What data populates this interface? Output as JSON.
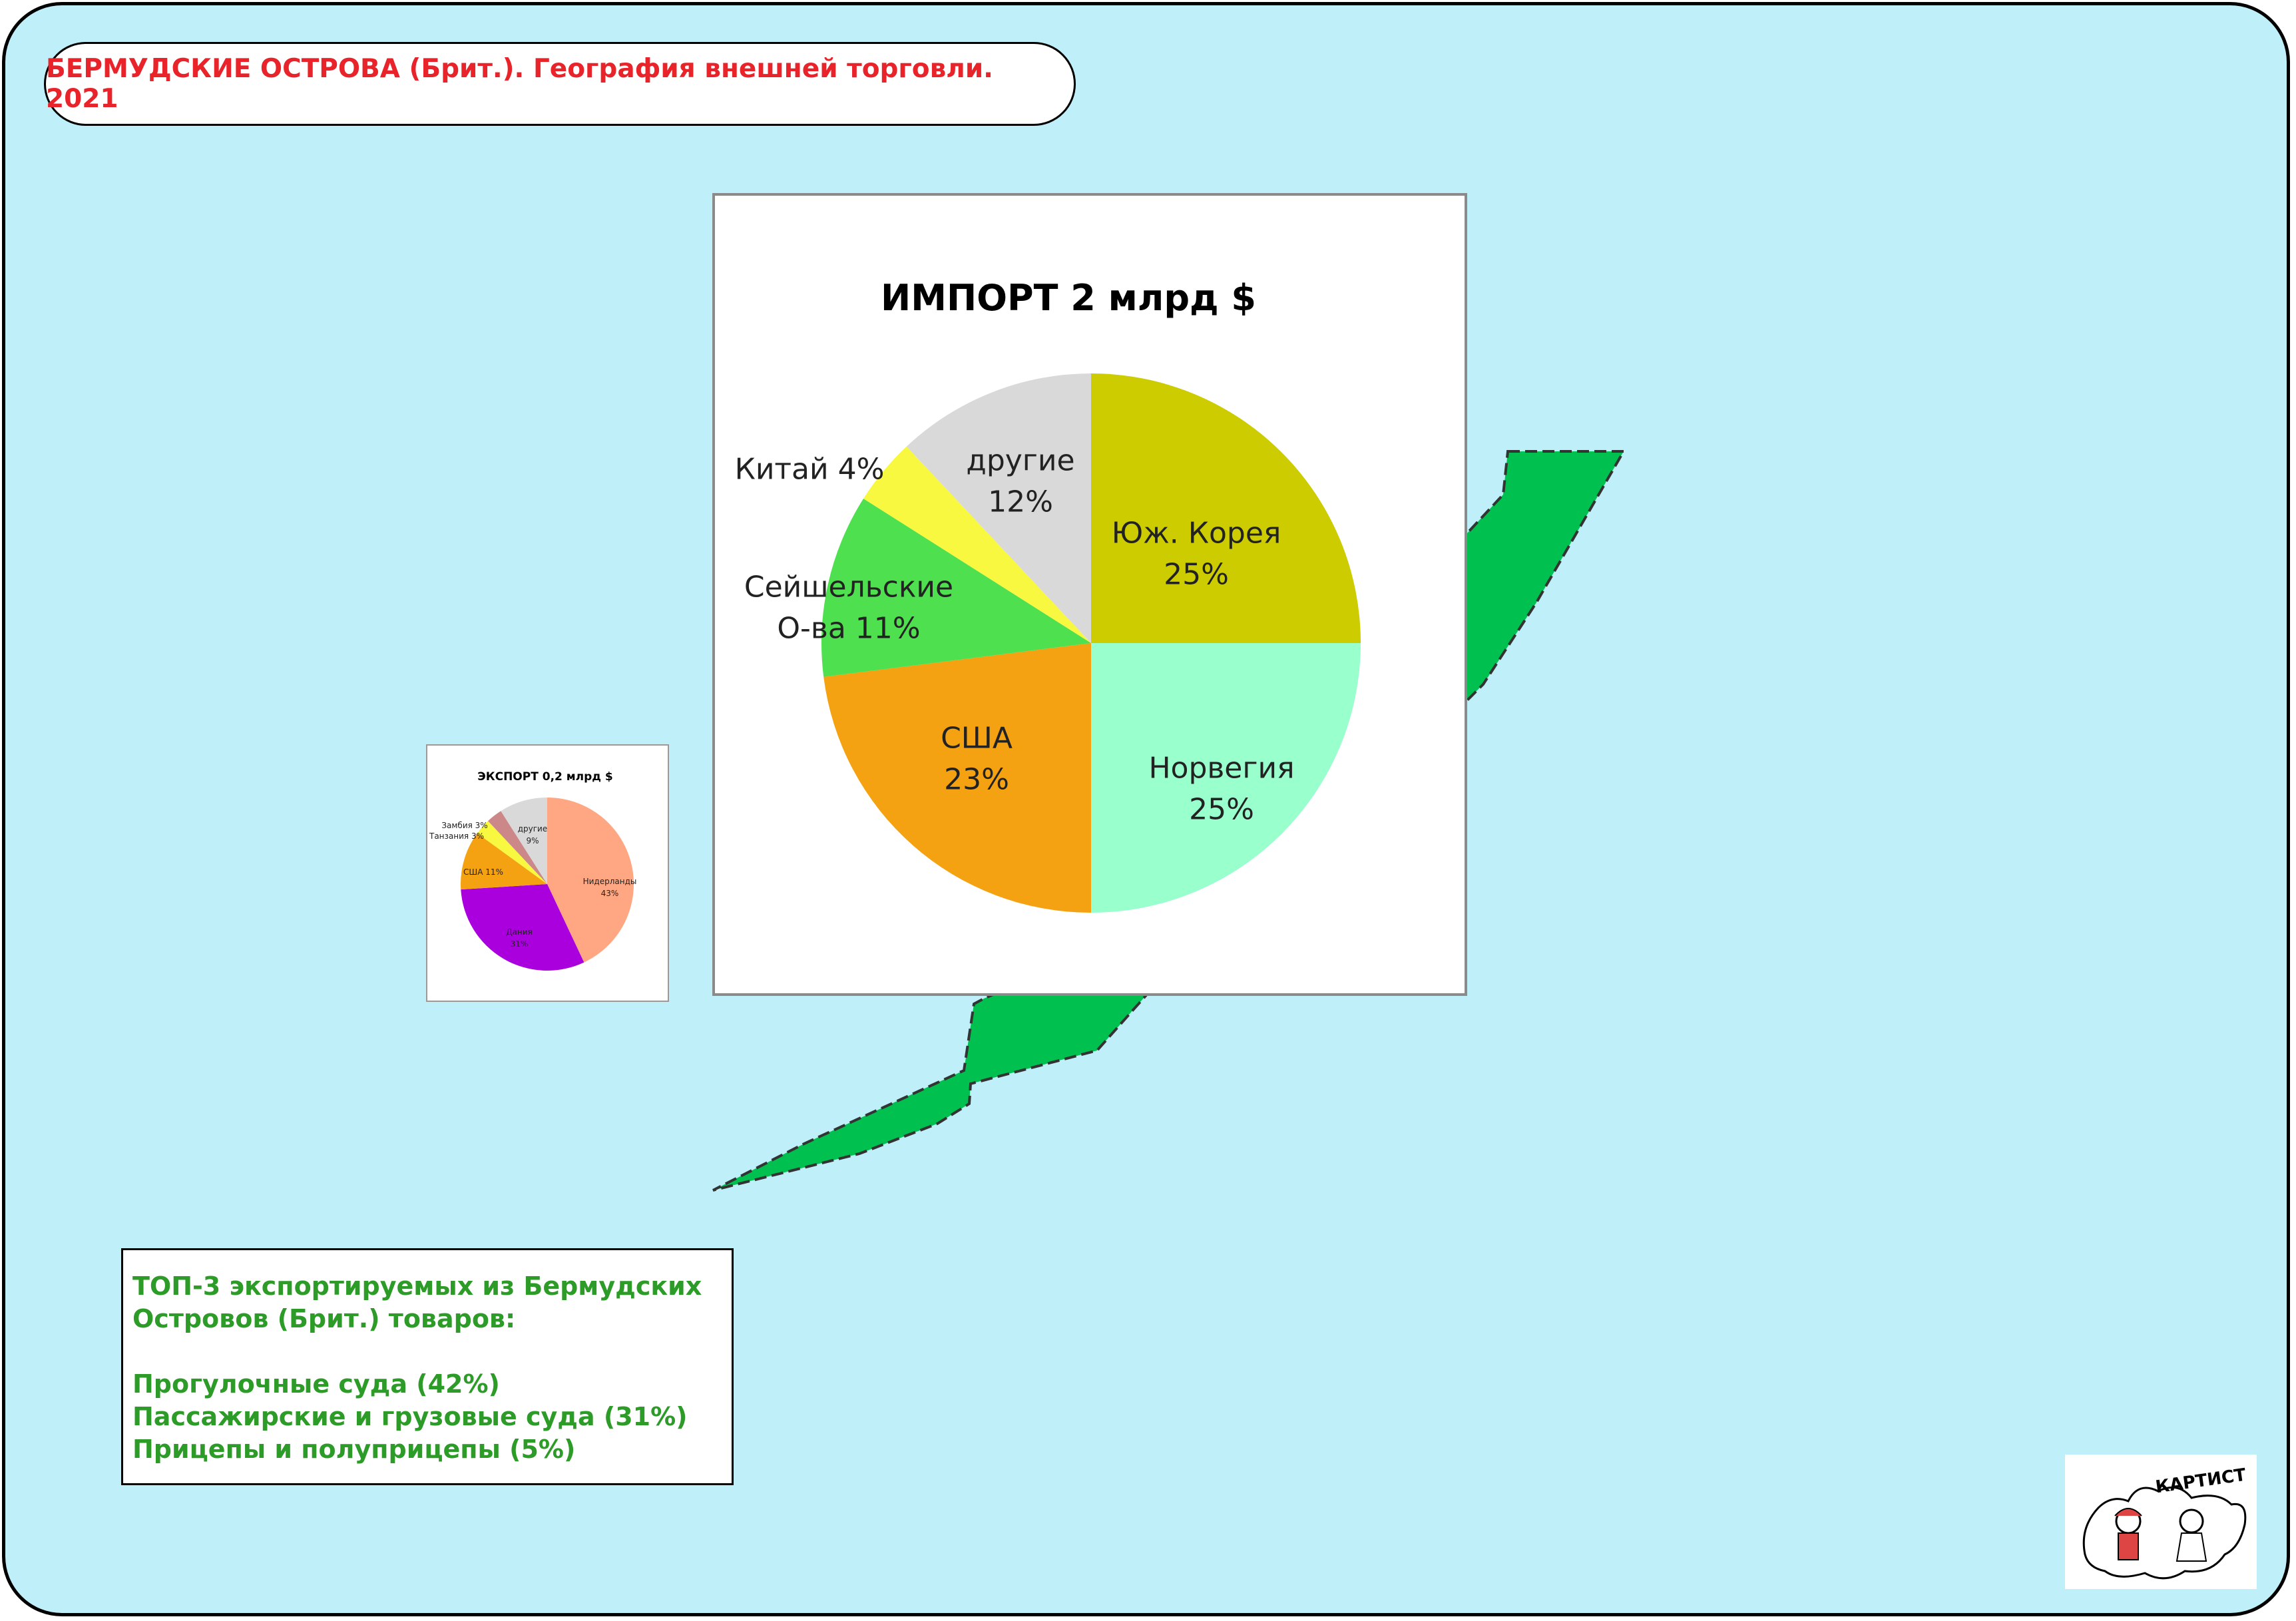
{
  "header": {
    "title": "БЕРМУДСКИЕ ОСТРОВА (Брит.). География внешней торговли. 2021"
  },
  "colors": {
    "ocean": "#bff0fa",
    "island": "#00c050",
    "title_text": "#e8232a",
    "info_text": "#2d9b27"
  },
  "chart_data": [
    {
      "type": "pie",
      "title": "ИМПОРТ 2 млрд $",
      "slices": [
        {
          "name": "Юж. Корея",
          "label_lines": [
            "Юж. Корея",
            "25%"
          ],
          "value": 25,
          "color": "#cccc00"
        },
        {
          "name": "Норвегия",
          "label_lines": [
            "Норвегия",
            "25%"
          ],
          "value": 25,
          "color": "#99ffcc"
        },
        {
          "name": "США",
          "label_lines": [
            "США",
            "23%"
          ],
          "value": 23,
          "color": "#f5a212"
        },
        {
          "name": "Сейшельские О-ва",
          "label_lines": [
            "Сейшельские",
            "О-ва 11%"
          ],
          "value": 11,
          "color": "#4ee04e"
        },
        {
          "name": "Китай",
          "label_lines": [
            "Китай 4%"
          ],
          "value": 4,
          "color": "#f8f840"
        },
        {
          "name": "другие",
          "label_lines": [
            "другие",
            "12%"
          ],
          "value": 12,
          "color": "#d9d9d9"
        }
      ]
    },
    {
      "type": "pie",
      "title": "ЭКСПОРТ 0,2 млрд $",
      "slices": [
        {
          "name": "Нидерланды",
          "label_lines": [
            "Нидерланды",
            "43%"
          ],
          "value": 43,
          "color": "#ffa782"
        },
        {
          "name": "Дания",
          "label_lines": [
            "Дания",
            "31%"
          ],
          "value": 31,
          "color": "#aa00dd"
        },
        {
          "name": "США",
          "label_lines": [
            "США 11%"
          ],
          "value": 11,
          "color": "#f5a212"
        },
        {
          "name": "Танзания",
          "label_lines": [
            "Танзания 3%"
          ],
          "value": 3,
          "color": "#f8f840"
        },
        {
          "name": "Замбия",
          "label_lines": [
            "Замбия 3%"
          ],
          "value": 3,
          "color": "#cc8888"
        },
        {
          "name": "другие",
          "label_lines": [
            "другие",
            "9%"
          ],
          "value": 9,
          "color": "#d9d9d9"
        }
      ]
    }
  ],
  "top3": {
    "heading_line1": "ТОП-3 экспортируемых из Бермудских",
    "heading_line2": "Островов (Брит.) товаров:",
    "items": [
      "Прогулочные суда (42%)",
      "Пассажирские и грузовые суда (31%)",
      "Прицепы и полуприцепы (5%)"
    ]
  },
  "logo": {
    "text": "КАРТИСТ"
  }
}
